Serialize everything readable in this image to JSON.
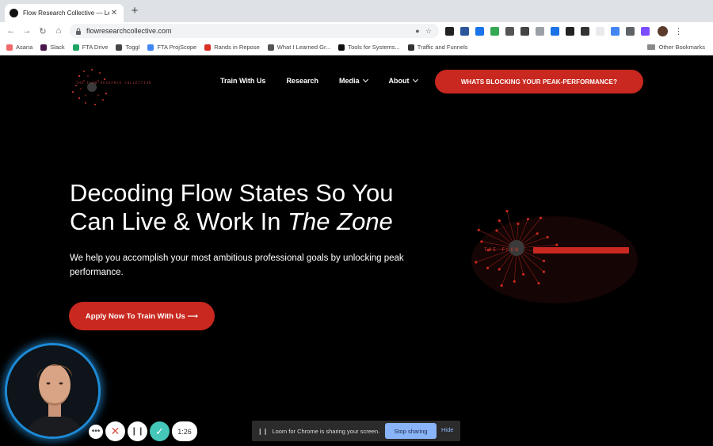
{
  "browser": {
    "tab_title": "Flow Research Collective — Le",
    "url": "flowresearchcollective.com",
    "bookmarks": [
      {
        "label": "Asana",
        "color": "#f06a6a"
      },
      {
        "label": "Slack",
        "color": "#4a154b"
      },
      {
        "label": "FTA Drive",
        "color": "#1fa463"
      },
      {
        "label": "Toggl",
        "color": "#444444"
      },
      {
        "label": "FTA ProjScope",
        "color": "#4285f4"
      },
      {
        "label": "Rands in Repose",
        "color": "#d93025"
      },
      {
        "label": "What I Learned Gr...",
        "color": "#555555"
      },
      {
        "label": "Tools for Systems...",
        "color": "#111111"
      },
      {
        "label": "Traffic and Funnels",
        "color": "#333333"
      }
    ],
    "other_bookmarks": "Other Bookmarks",
    "extension_colors": [
      "#222222",
      "#2b579a",
      "#1a73e8",
      "#34a853",
      "#555555",
      "#444444",
      "#9aa0a6",
      "#1a73e8",
      "#222222",
      "#333333",
      "#e8eaed",
      "#4285f4",
      "#5f6368",
      "#7c4dff"
    ]
  },
  "site": {
    "logo_text": "THE FLOW RESEARCH COLLECTIVE",
    "nav": [
      {
        "label": "Train With Us",
        "dropdown": false
      },
      {
        "label": "Research",
        "dropdown": false
      },
      {
        "label": "Media",
        "dropdown": true
      },
      {
        "label": "About",
        "dropdown": true
      }
    ],
    "cta_label": "WHATS BLOCKING YOUR PEAK-PERFORMANCE?",
    "hero": {
      "title_line1": "Decoding Flow States So You",
      "title_line2_prefix": "Can Live & Work In ",
      "title_line2_emphasis": "The Zone",
      "subtitle": "We help you accomplish your most ambitious professional goals by unlocking peak performance.",
      "apply_label": "Apply Now To Train With Us ⟶"
    },
    "flow_graphic_label": "THE FLOW",
    "brand_red": "#c8281f"
  },
  "loom": {
    "timer": "1:26",
    "share_text": "Loom for Chrome is sharing your screen.",
    "stop_label": "Stop sharing",
    "hide_label": "Hide"
  }
}
